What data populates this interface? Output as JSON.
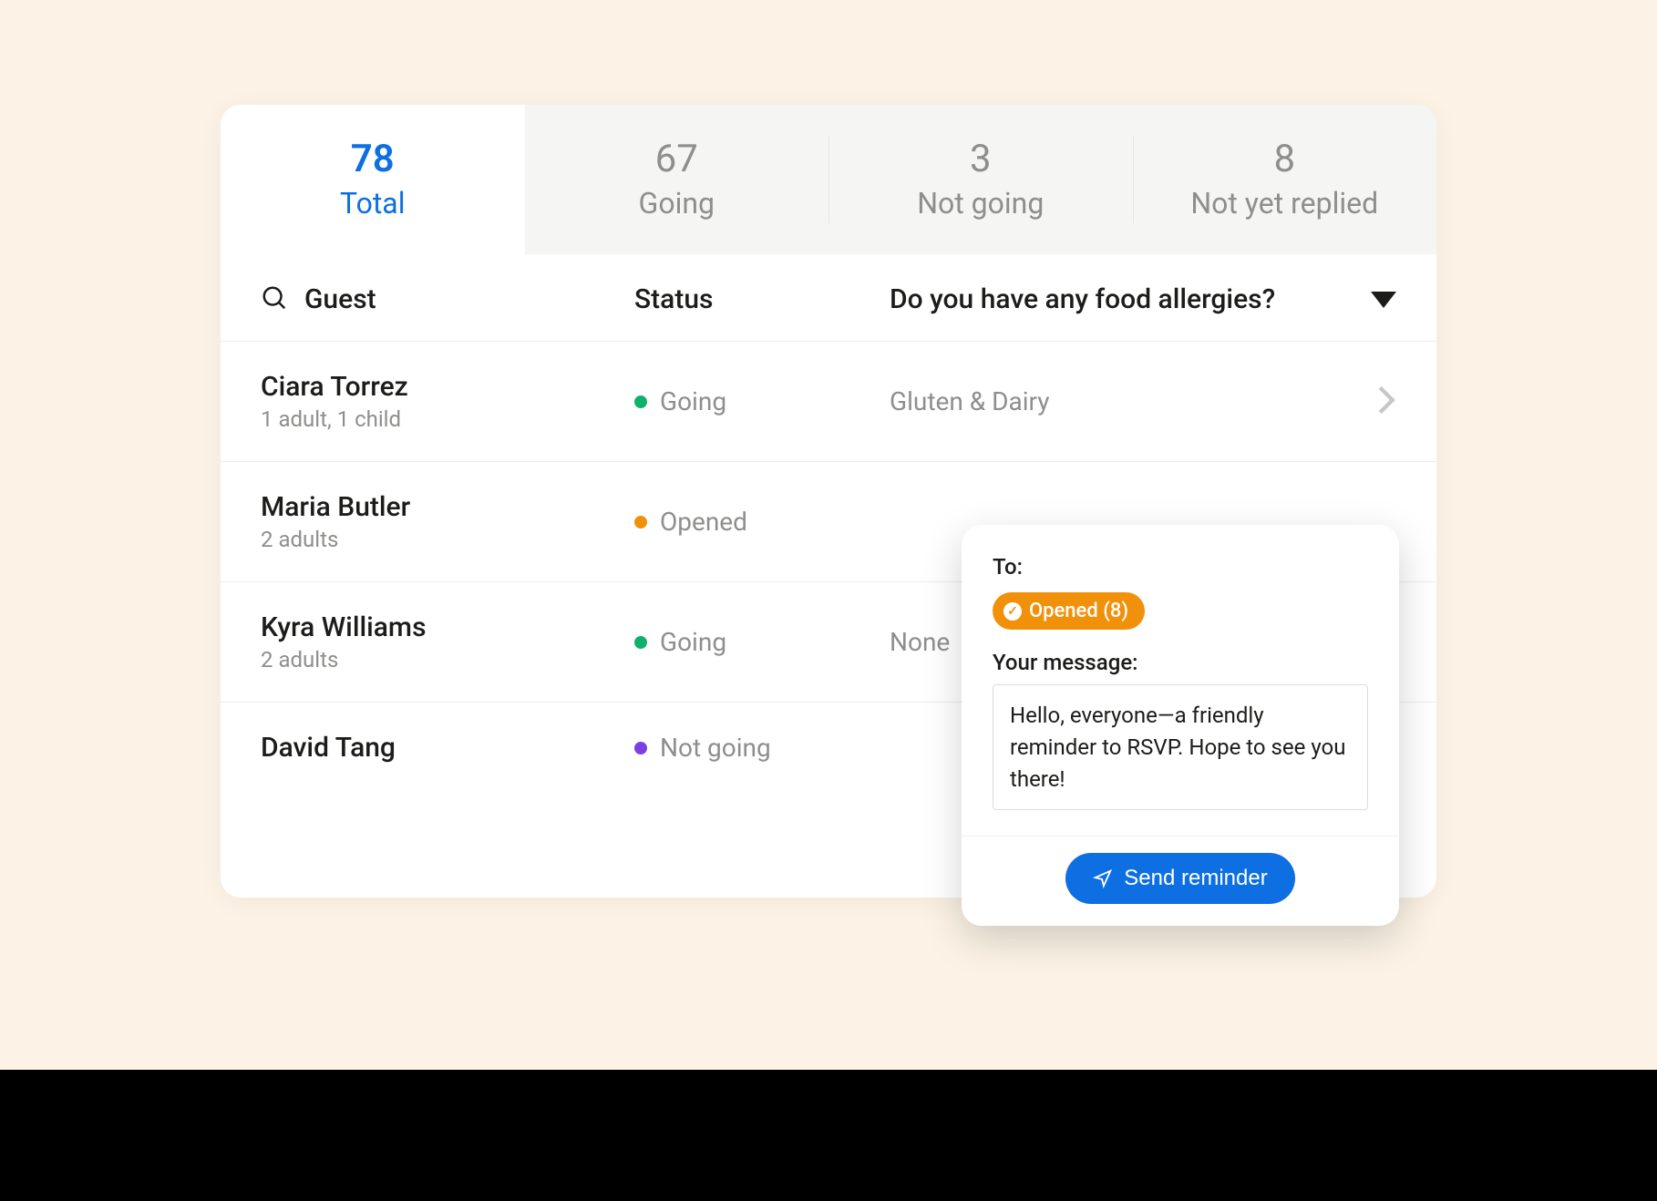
{
  "tabs": [
    {
      "count": "78",
      "label": "Total",
      "active": true
    },
    {
      "count": "67",
      "label": "Going",
      "active": false
    },
    {
      "count": "3",
      "label": "Not going",
      "active": false
    },
    {
      "count": "8",
      "label": "Not yet replied",
      "active": false
    }
  ],
  "columns": {
    "guest": "Guest",
    "status": "Status",
    "question": "Do you have any food allergies?"
  },
  "status_colors": {
    "Going": "#10b26b",
    "Opened": "#f09109",
    "Not going": "#7b3fe4"
  },
  "guests": [
    {
      "name": "Ciara Torrez",
      "detail": "1 adult, 1 child",
      "status": "Going",
      "answer": "Gluten & Dairy",
      "chevron": true
    },
    {
      "name": "Maria Butler",
      "detail": "2 adults",
      "status": "Opened",
      "answer": "",
      "chevron": false
    },
    {
      "name": "Kyra Williams",
      "detail": "2 adults",
      "status": "Going",
      "answer": "None",
      "chevron": false
    },
    {
      "name": "David Tang",
      "detail": "",
      "status": "Not going",
      "answer": "",
      "chevron": false
    }
  ],
  "compose": {
    "to_label": "To:",
    "chip_label": "Opened (8)",
    "message_label": "Your message:",
    "message_value": "Hello, everyone—a friendly reminder to RSVP. Hope to see you there!",
    "send_label": "Send reminder"
  }
}
